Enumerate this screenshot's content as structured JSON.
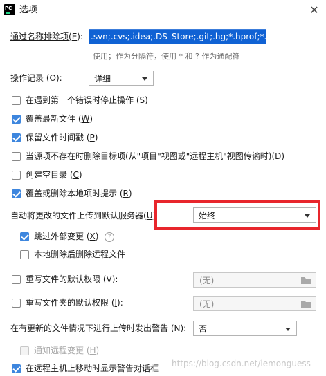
{
  "window": {
    "title": "选项"
  },
  "exclude": {
    "label_pre": "通过名称排除项(",
    "label_key": "E",
    "label_post": "):",
    "value": ".svn;.cvs;.idea;.DS_Store;.git;.hg;*.hprof;*.pyc",
    "hint": "使用；作为分隔符，使用 * 和 ? 作为通配符"
  },
  "operation_log": {
    "label_pre": "操作记录 (",
    "label_key": "O",
    "label_post": "):",
    "value": "详细"
  },
  "checkboxes": [
    {
      "pre": "在遇到第一个错误时停止操作 (",
      "key": "S",
      "post": ")",
      "checked": false
    },
    {
      "pre": "覆盖最新文件 (",
      "key": "W",
      "post": ")",
      "checked": true
    },
    {
      "pre": "保留文件时间戳 (",
      "key": "P",
      "post": ")",
      "checked": true
    },
    {
      "pre": "当源项不存在时删除目标项(从\"项目\"视图或\"远程主机\"视图传输时)(",
      "key": "D",
      "post": ")",
      "checked": false
    },
    {
      "pre": "创建空目录 (",
      "key": "C",
      "post": ")",
      "checked": false
    },
    {
      "pre": "覆盖或删除本地项时提示 (",
      "key": "R",
      "post": ")",
      "checked": true
    }
  ],
  "upload_default": {
    "label_pre": "自动将更改的文件上传到默认服务器(",
    "label_key": "U",
    "label_post": ")",
    "value": "始终"
  },
  "skip_external": {
    "pre": "跳过外部变更 (",
    "key": "X",
    "post": ")",
    "checked": true
  },
  "delete_remote": {
    "label": "本地删除后删除远程文件",
    "checked": false
  },
  "file_permissions": {
    "pre": "重写文件的默认权限 (",
    "key": "V",
    "post": "):",
    "checked": false,
    "value": "(无)"
  },
  "folder_permissions": {
    "pre": "重写文件夹的默认权限 (",
    "key": "I",
    "post": "):",
    "checked": false,
    "value": "(无)"
  },
  "warn_upload": {
    "label_pre": "在有更新的文件情况下进行上传时发出警告 (",
    "label_key": "N",
    "label_post": "):",
    "value": "否"
  },
  "notify_remote": {
    "pre": "通知远程变更 (",
    "key": "H",
    "post": ")",
    "checked": false
  },
  "move_warning": {
    "label": "在远程主机上移动时显示警告对话框",
    "checked": true
  },
  "watermark": "https://blog.csdn.net/lemonguess",
  "colors": {
    "accent": "#3d86de",
    "highlight": "#e8262c",
    "selection": "#1062d4"
  }
}
